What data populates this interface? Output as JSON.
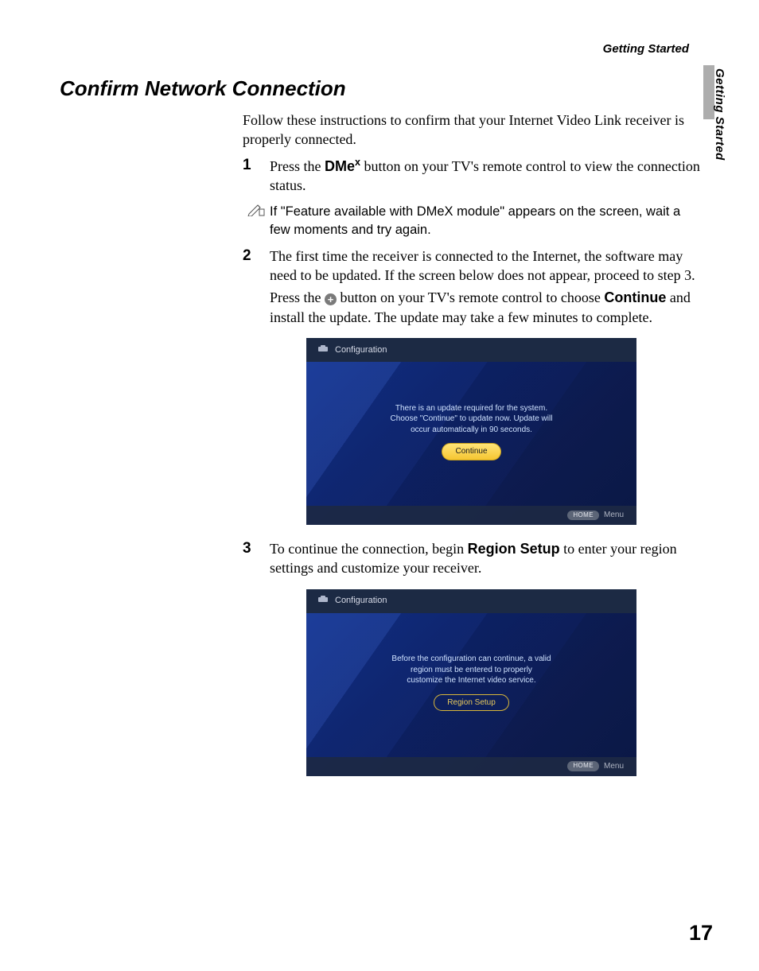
{
  "running_head": "Getting Started",
  "side_label": "Getting Started",
  "section_title": "Confirm Network Connection",
  "intro": "Follow these instructions to confirm that your Internet Video Link receiver is properly connected.",
  "steps": {
    "s1": {
      "num": "1",
      "pre": "Press the ",
      "button_base": "DMe",
      "button_sup": "x",
      "post": " button on your TV's remote control to view the connection status."
    },
    "note": "If \"Feature available with DMeX module\" appears on the screen, wait a few moments and try again.",
    "s2": {
      "num": "2",
      "p1": "The first time the receiver is connected to the Internet, the software may need to be updated. If the screen below does not appear, proceed to step 3.",
      "p2_pre": "Press the ",
      "p2_mid": " button on your TV's remote control to choose ",
      "p2_bold": "Continue",
      "p2_post": " and install the update. The update may take a few minutes to complete."
    },
    "s3": {
      "num": "3",
      "pre": "To continue the connection, begin ",
      "bold": "Region Setup",
      "post": " to enter your region settings and customize your receiver."
    }
  },
  "tv1": {
    "header": "Configuration",
    "msg_l1": "There is an update required for the system.",
    "msg_l2": "Choose \"Continue\" to update now. Update will",
    "msg_l3": "occur automatically in 90 seconds.",
    "button": "Continue",
    "home": "HOME",
    "menu": "Menu"
  },
  "tv2": {
    "header": "Configuration",
    "msg_l1": "Before the configuration can continue, a valid",
    "msg_l2": "region must be entered to properly",
    "msg_l3": "customize the Internet video service.",
    "button": "Region Setup",
    "home": "HOME",
    "menu": "Menu"
  },
  "page_number": "17"
}
